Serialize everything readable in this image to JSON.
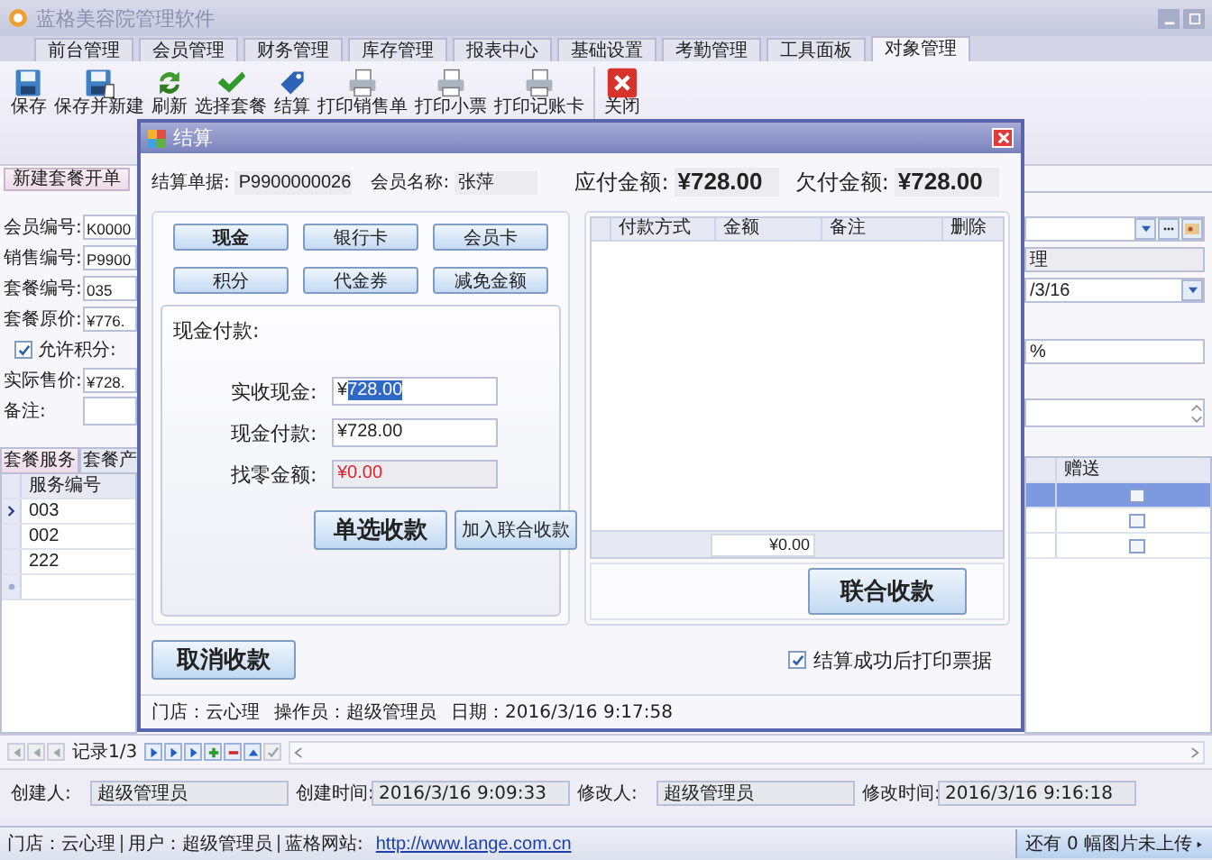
{
  "window": {
    "title": "蓝格美容院管理软件"
  },
  "menu_tabs": [
    {
      "label": "前台管理",
      "selected": false
    },
    {
      "label": "会员管理",
      "selected": false
    },
    {
      "label": "财务管理",
      "selected": false
    },
    {
      "label": "库存管理",
      "selected": false
    },
    {
      "label": "报表中心",
      "selected": false
    },
    {
      "label": "基础设置",
      "selected": false
    },
    {
      "label": "考勤管理",
      "selected": false
    },
    {
      "label": "工具面板",
      "selected": false
    },
    {
      "label": "对象管理",
      "selected": true
    }
  ],
  "toolbar": [
    {
      "label": "保存",
      "kind": "floppy"
    },
    {
      "label": "保存并新建",
      "kind": "floppy_new"
    },
    {
      "label": "刷新",
      "kind": "refresh"
    },
    {
      "label": "选择套餐",
      "kind": "check"
    },
    {
      "label": "结算",
      "kind": "tag"
    },
    {
      "label": "打印销售单",
      "kind": "printer"
    },
    {
      "label": "打印小票",
      "kind": "printer"
    },
    {
      "label": "打印记账卡",
      "kind": "printer"
    },
    {
      "label": "关闭",
      "kind": "close"
    }
  ],
  "doc_tab": {
    "label": "新建套餐开单"
  },
  "form": [
    {
      "kind": "field",
      "label": "会员编号:",
      "value": "K0000"
    },
    {
      "kind": "field",
      "label": "销售编号:",
      "value": "P9900"
    },
    {
      "kind": "field",
      "label": "套餐编号:",
      "value": "035"
    },
    {
      "kind": "field",
      "label": "套餐原价:",
      "value": "¥776."
    },
    {
      "kind": "checkbox",
      "label": "允许积分:",
      "checked": true
    },
    {
      "kind": "field",
      "label": "实际售价:",
      "value": "¥728."
    },
    {
      "kind": "memo",
      "label": "备注:"
    }
  ],
  "right_fields": [
    {
      "kind": "combo"
    },
    {
      "kind": "readonly",
      "value": "理"
    },
    {
      "kind": "date",
      "value": "/3/16"
    },
    {
      "kind": "blank"
    },
    {
      "kind": "input",
      "value": "%"
    },
    {
      "kind": "blank"
    },
    {
      "kind": "memo"
    }
  ],
  "sub_tabs": [
    {
      "label": "套餐服务",
      "selected": true
    },
    {
      "label": "套餐产",
      "selected": false
    }
  ],
  "grid": {
    "column": "服务编号",
    "right_column": "赠送",
    "rows": [
      {
        "code": "003",
        "gift": false,
        "selected": true
      },
      {
        "code": "002",
        "gift": false,
        "selected": false
      },
      {
        "code": "222",
        "gift": false,
        "selected": false
      }
    ]
  },
  "navigator": {
    "record": "记录1/3"
  },
  "audit": [
    {
      "label": "创建人:",
      "value": "超级管理员"
    },
    {
      "label": "创建时间:",
      "value": "2016/3/16 9:09:33"
    },
    {
      "label": "修改人:",
      "value": "超级管理员"
    },
    {
      "label": "修改时间:",
      "value": "2016/3/16 9:16:18"
    }
  ],
  "status_bar": {
    "items": [
      "门店：云心理",
      "用户：超级管理员",
      "蓝格网站:"
    ],
    "link": "http://www.lange.com.cn",
    "upload": "还有 0 幅图片未上传"
  },
  "dialog": {
    "title": "结算",
    "bill": {
      "label": "结算单据:",
      "value": "P9900000026"
    },
    "member": {
      "label": "会员名称:",
      "value": "张萍"
    },
    "payable": {
      "label": "应付金额:",
      "value": "¥728.00"
    },
    "owed": {
      "label": "欠付金额:",
      "value": "¥728.00"
    },
    "methods": [
      {
        "label": "现金",
        "selected": true
      },
      {
        "label": "银行卡",
        "selected": false
      },
      {
        "label": "会员卡",
        "selected": false
      },
      {
        "label": "积分",
        "selected": false
      },
      {
        "label": "代金券",
        "selected": false
      },
      {
        "label": "减免金额",
        "selected": false
      }
    ],
    "cash": {
      "title": "现金付款:",
      "fields": [
        {
          "kind": "input",
          "label": "实收现金:",
          "value": "¥",
          "highlight": "728.00"
        },
        {
          "kind": "input",
          "label": "现金付款:",
          "value": "¥728.00"
        },
        {
          "kind": "readonly",
          "label": "找零金额:",
          "value": "¥0.00"
        }
      ],
      "buttons": [
        "单选收款",
        "加入联合收款"
      ]
    },
    "payments": {
      "columns": [
        "付款方式",
        "金额",
        "备注",
        "删除"
      ],
      "total": "¥0.00",
      "button": "联合收款"
    },
    "cancel_button": "取消收款",
    "print_after": {
      "label": "结算成功后打印票据",
      "checked": true
    },
    "status": [
      "门店：云心理",
      "操作员：超级管理员",
      "日期：2016/3/16 9:17:58"
    ]
  }
}
